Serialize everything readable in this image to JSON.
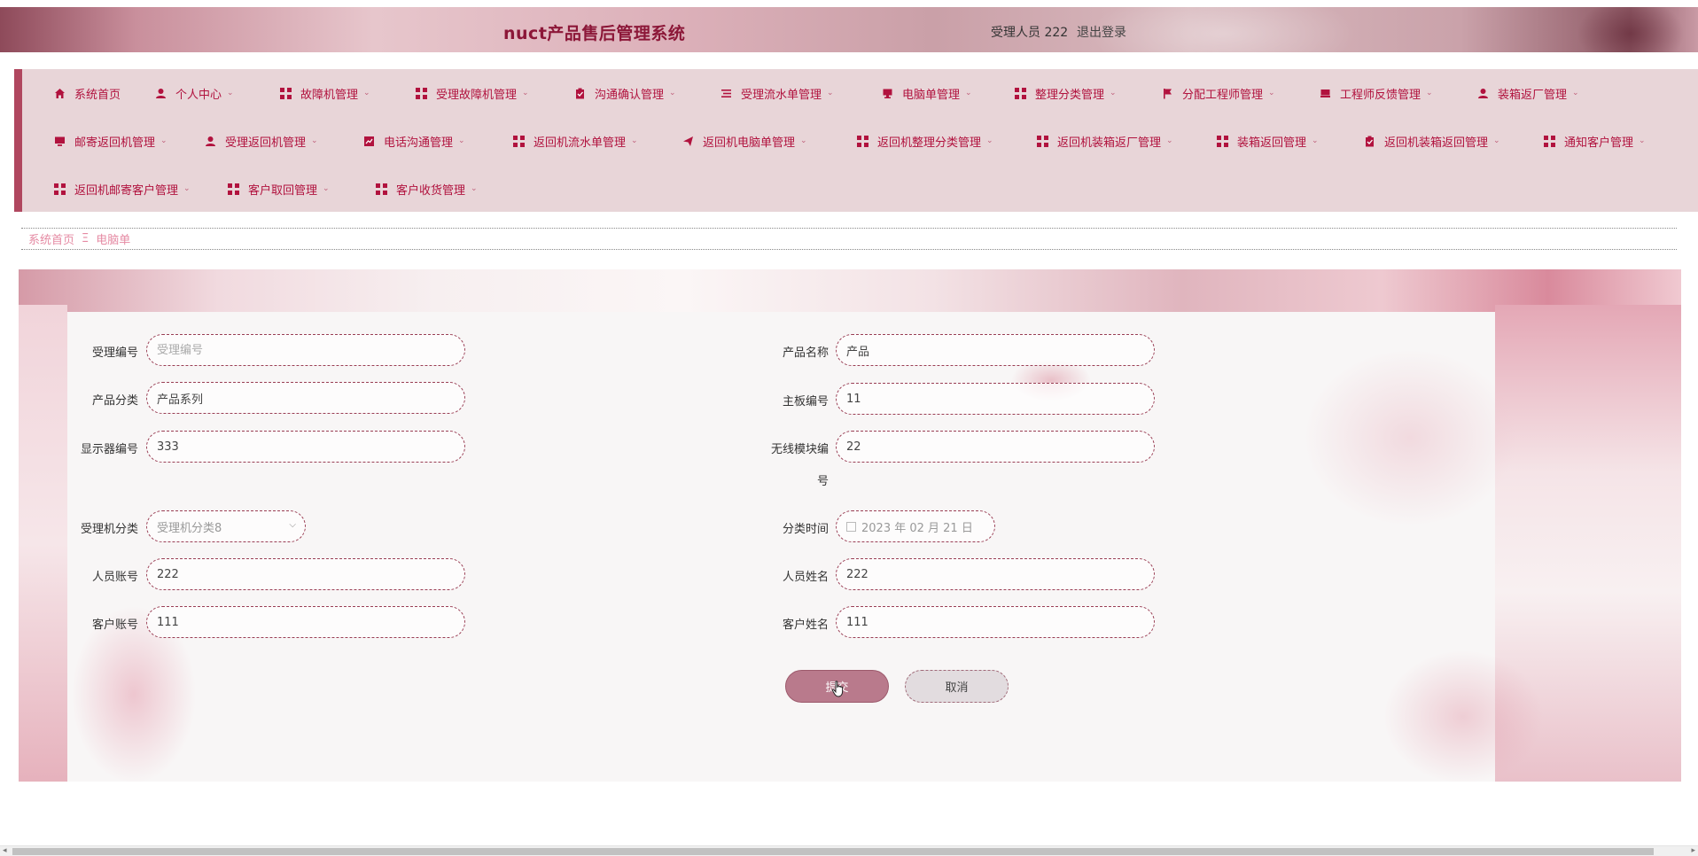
{
  "header": {
    "title": "nuct产品售后管理系统",
    "user_label": "受理人员 222",
    "logout": "退出登录"
  },
  "nav": {
    "items": [
      {
        "label": "系统首页",
        "icon": "home-icon"
      },
      {
        "label": "个人中心",
        "icon": "user-icon"
      },
      {
        "label": "故障机管理",
        "icon": "grid-icon"
      },
      {
        "label": "受理故障机管理",
        "icon": "grid-icon"
      },
      {
        "label": "沟通确认管理",
        "icon": "clipboard-icon"
      },
      {
        "label": "受理流水单管理",
        "icon": "list-icon"
      },
      {
        "label": "电脑单管理",
        "icon": "computer-icon"
      },
      {
        "label": "整理分类管理",
        "icon": "grid-icon"
      },
      {
        "label": "分配工程师管理",
        "icon": "flag-icon"
      },
      {
        "label": "工程师反馈管理",
        "icon": "computer-icon"
      },
      {
        "label": "装箱返厂管理",
        "icon": "user-icon"
      },
      {
        "label": "邮寄返回机管理",
        "icon": "monitor-icon"
      },
      {
        "label": "受理返回机管理",
        "icon": "user-icon"
      },
      {
        "label": "电话沟通管理",
        "icon": "chart-icon"
      },
      {
        "label": "返回机流水单管理",
        "icon": "grid-icon"
      },
      {
        "label": "返回机电脑单管理",
        "icon": "send-icon"
      },
      {
        "label": "返回机整理分类管理",
        "icon": "grid-icon"
      },
      {
        "label": "返回机装箱返厂管理",
        "icon": "grid-icon"
      },
      {
        "label": "装箱返回管理",
        "icon": "grid-icon"
      },
      {
        "label": "返回机装箱返回管理",
        "icon": "check-icon"
      },
      {
        "label": "通知客户管理",
        "icon": "grid-icon"
      },
      {
        "label": "返回机邮寄客户管理",
        "icon": "grid-icon"
      },
      {
        "label": "客户取回管理",
        "icon": "grid-icon"
      },
      {
        "label": "客户收货管理",
        "icon": "grid-icon"
      }
    ]
  },
  "breadcrumb": {
    "home": "系统首页",
    "separator": "Ξ",
    "current": "电脑单"
  },
  "form": {
    "accept_no": {
      "label": "受理编号",
      "value": "",
      "placeholder": "受理编号"
    },
    "product_name": {
      "label": "产品名称",
      "value": "产品"
    },
    "product_category": {
      "label": "产品分类",
      "value": "产品系列"
    },
    "board_no": {
      "label": "主板编号",
      "value": "11"
    },
    "display_no": {
      "label": "显示器编号",
      "value": "333"
    },
    "wireless_no": {
      "label_line1": "无线模块编",
      "label_line2": "号",
      "value": "22"
    },
    "machine_category": {
      "label": "受理机分类",
      "value": "受理机分类8"
    },
    "category_time": {
      "label": "分类时间",
      "value": "2023 年 02 月 21 日"
    },
    "staff_account": {
      "label": "人员账号",
      "value": "222"
    },
    "staff_name": {
      "label": "人员姓名",
      "value": "222"
    },
    "customer_account": {
      "label": "客户账号",
      "value": "111"
    },
    "customer_name": {
      "label": "客户姓名",
      "value": "111"
    },
    "submit": "提交",
    "cancel": "取消"
  },
  "colors": {
    "accent": "#b1123e",
    "title": "#8c1738",
    "nav_bg": "#e8d5d8",
    "submit_bg": "#b97a8c"
  }
}
